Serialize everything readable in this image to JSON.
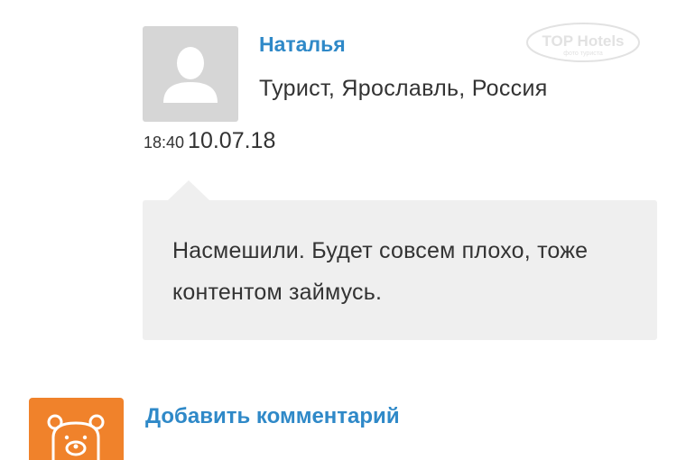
{
  "comment": {
    "author_name": "Наталья",
    "author_info": "Турист, Ярославль, Россия",
    "time": "18:40",
    "date": "10.07.18",
    "text": "Насмешили. Будет совсем плохо, тоже контентом займусь."
  },
  "watermark": {
    "brand": "TOP Hotels",
    "tagline": "фото туриста"
  },
  "actions": {
    "add_comment_label": "Добавить комментарий"
  },
  "icons": {
    "avatar": "user-silhouette-icon",
    "add_comment": "bear-icon"
  },
  "colors": {
    "link": "#2f89c8",
    "accent": "#f0822b",
    "bubble": "#efefef",
    "avatar_bg": "#d6d6d6"
  }
}
